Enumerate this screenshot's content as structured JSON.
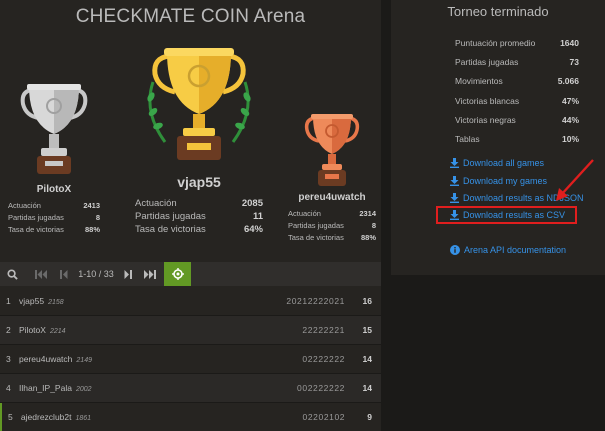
{
  "arena": {
    "title": "CHECKMATE COIN Arena",
    "stat_labels": {
      "performance": "Actuación",
      "games": "Partidas jugadas",
      "win_rate": "Tasa de victorias"
    },
    "podium": {
      "first": {
        "name": "vjap55",
        "performance": "2085",
        "games": "11",
        "win_rate": "64%"
      },
      "second": {
        "name": "PilotoX",
        "performance": "2413",
        "games": "8",
        "win_rate": "88%"
      },
      "third": {
        "name": "pereu4uwatch",
        "performance": "2314",
        "games": "8",
        "win_rate": "88%"
      }
    },
    "pager": {
      "range": "1-10 / 33",
      "icons": {
        "search": "search-icon",
        "first": "first-page-icon",
        "prev": "prev-page-icon",
        "next": "next-page-icon",
        "last": "last-page-icon",
        "me": "target-icon"
      }
    },
    "standings": [
      {
        "rank": "1",
        "name": "vjap55",
        "rating": "2158",
        "scores": "20212222021",
        "total": "16"
      },
      {
        "rank": "2",
        "name": "PilotoX",
        "rating": "2214",
        "scores": "22222221",
        "total": "15"
      },
      {
        "rank": "3",
        "name": "pereu4uwatch",
        "rating": "2149",
        "scores": "02222222",
        "total": "14"
      },
      {
        "rank": "4",
        "name": "Ilhan_IP_Pala",
        "rating": "2002",
        "scores": "002222222",
        "total": "14"
      },
      {
        "rank": "5",
        "name": "ajedrezclub2t",
        "rating": "1861",
        "scores": "02202102",
        "total": "9"
      }
    ]
  },
  "side": {
    "title": "Torneo terminado",
    "summary": [
      {
        "label": "Puntuación promedio",
        "value": "1640"
      },
      {
        "label": "Partidas jugadas",
        "value": "73"
      },
      {
        "label": "Movimientos",
        "value": "5.066"
      },
      {
        "label": "Victorias blancas",
        "value": "47%"
      },
      {
        "label": "Victorias negras",
        "value": "44%"
      },
      {
        "label": "Tablas",
        "value": "10%"
      }
    ],
    "downloads": {
      "all_games": "Download all games",
      "my_games": "Download my games",
      "results_ndjson": "Download results as NDJSON",
      "results_csv": "Download results as CSV"
    },
    "api_doc": "Arena API documentation"
  },
  "colors": {
    "accent_green": "#629924",
    "link_blue": "#3692e7",
    "highlight_red": "#e01e1e",
    "gold": "#f5c33b",
    "silver": "#c8c8c8",
    "bronze": "#e8774a"
  }
}
